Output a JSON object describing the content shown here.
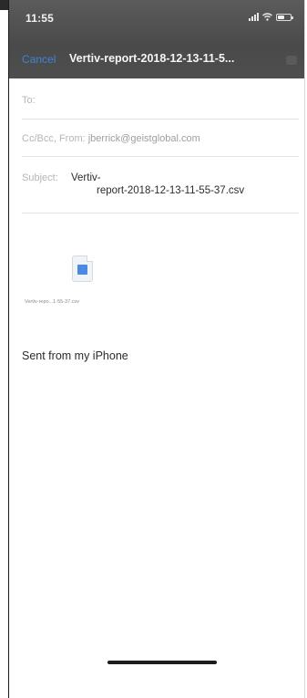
{
  "status_bar": {
    "time": "11:55",
    "icons": [
      "signal-icon",
      "wifi-icon",
      "battery-icon"
    ]
  },
  "nav": {
    "cancel_label": "Cancel",
    "title": "Vertiv-report-2018-12-13-11-5..."
  },
  "fields": {
    "to_label": "To:",
    "cc_label": "Cc/Bcc, From:",
    "from_value": "jberrick@geistglobal.com",
    "subject_label": "Subject:",
    "subject_line1": "Vertiv-",
    "subject_line2": "report-2018-12-13-11-55-37.csv"
  },
  "attachment": {
    "icon": "spreadsheet-file-icon",
    "filename": "Vertiv-repo...1-55-37.csv"
  },
  "body": {
    "signature": "Sent from my iPhone"
  },
  "colors": {
    "header_bg": "#4e4e4e",
    "accent": "#3b86d6",
    "attachment_icon": "#4a8ae2"
  }
}
